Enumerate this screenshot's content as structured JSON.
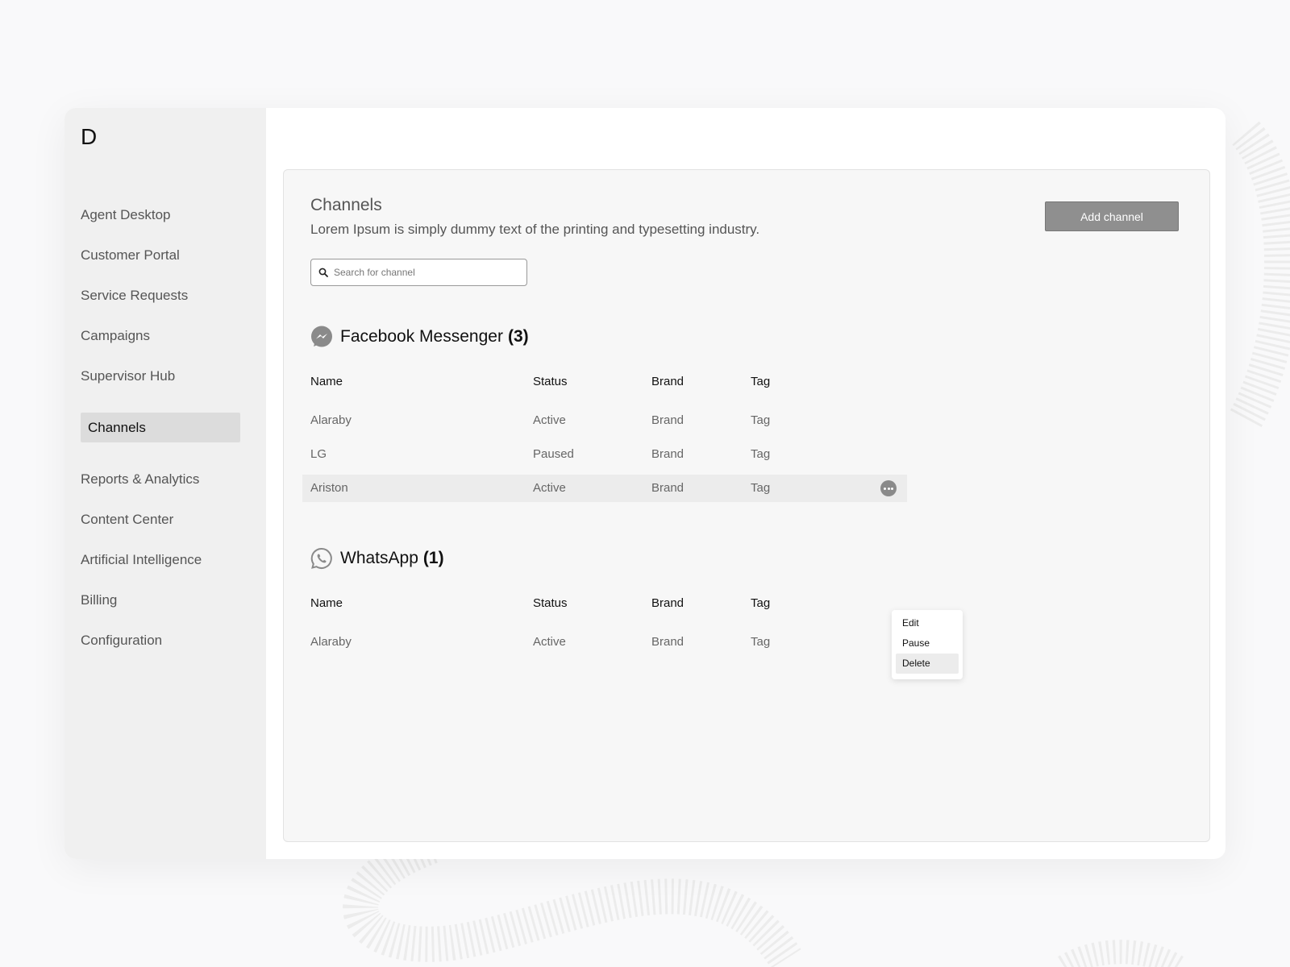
{
  "app": {
    "logo": "D"
  },
  "sidebar": {
    "items": [
      {
        "label": "Agent Desktop"
      },
      {
        "label": "Customer Portal"
      },
      {
        "label": "Service Requests"
      },
      {
        "label": "Campaigns"
      },
      {
        "label": "Supervisor Hub"
      },
      {
        "label": "Channels",
        "active": true
      },
      {
        "label": "Reports & Analytics"
      },
      {
        "label": "Content Center"
      },
      {
        "label": "Artificial Intelligence"
      },
      {
        "label": "Billing"
      },
      {
        "label": "Configuration"
      }
    ]
  },
  "header": {
    "title": "Channels",
    "description": "Lorem Ipsum is simply dummy text of the printing and typesetting industry.",
    "add_button": "Add channel"
  },
  "search": {
    "placeholder": "Search for channel",
    "value": ""
  },
  "columns": [
    "Name",
    "Status",
    "Brand",
    "Tag"
  ],
  "sections": [
    {
      "icon": "messenger-icon",
      "title": "Facebook Messenger",
      "count": "(3)",
      "rows": [
        {
          "name": "Alaraby",
          "status": "Active",
          "brand": "Brand",
          "tag": "Tag"
        },
        {
          "name": "LG",
          "status": "Paused",
          "brand": "Brand",
          "tag": "Tag"
        },
        {
          "name": "Ariston",
          "status": "Active",
          "brand": "Brand",
          "tag": "Tag"
        }
      ]
    },
    {
      "icon": "whatsapp-icon",
      "title": "WhatsApp",
      "count": "(1)",
      "rows": [
        {
          "name": "Alaraby",
          "status": "Active",
          "brand": "Brand",
          "tag": "Tag"
        }
      ]
    }
  ],
  "row_menu": {
    "items": [
      {
        "label": "Edit"
      },
      {
        "label": "Pause"
      },
      {
        "label": "Delete",
        "active": true
      }
    ]
  },
  "colors": {
    "background": "#f9f9fa",
    "sidebar": "#f0f0f0",
    "sidebar_active": "#dcdcdc",
    "button": "#8f8f8f",
    "decor": "#ececec"
  }
}
